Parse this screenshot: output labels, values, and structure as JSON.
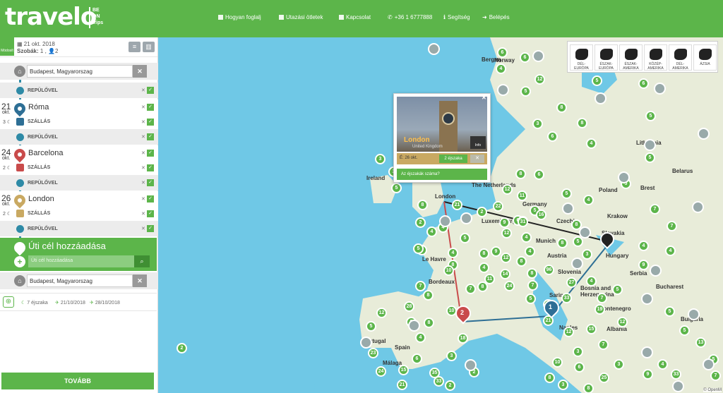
{
  "header": {
    "logo": "travelo",
    "logo_badge": "BE ON trips",
    "nav": [
      {
        "label": "Hogyan foglalj",
        "icon": "book-icon"
      },
      {
        "label": "Utazási ötletek",
        "icon": "book-icon"
      },
      {
        "label": "Kapcsolat",
        "icon": "book-icon"
      },
      {
        "label": "+36 1 6777888",
        "icon": "phone-icon"
      },
      {
        "label": "Segítség",
        "icon": "info-icon"
      },
      {
        "label": "Belépés",
        "icon": "login-icon"
      }
    ]
  },
  "sidebar": {
    "modosit_label": "Módosít",
    "trip_date": "21 okt. 2018",
    "rooms_label": "Szobák:",
    "rooms_value": "1 ,",
    "persons_value": "2",
    "start_place": "Budapest, Magyarorszag",
    "end_place": "Budapest, Magyarorszag",
    "leg_label": "REPÜLŐVEL",
    "stay_label": "SZÁLLÁS",
    "stops": [
      {
        "day": "21",
        "month": "okt.",
        "city": "Róma",
        "nights": "3",
        "color": "#2e6f95"
      },
      {
        "day": "24",
        "month": "okt.",
        "city": "Barcelona",
        "nights": "2",
        "color": "#c94b4b"
      },
      {
        "day": "26",
        "month": "okt.",
        "city": "London",
        "nights": "2",
        "color": "#c9a962"
      }
    ],
    "add_title": "Úti cél hozzáadása",
    "add_placeholder": "Úti cél hozzáadása",
    "summary_nights": "7 éjszaka",
    "summary_depart": "21/10/2018",
    "summary_return": "28/10/2018",
    "next_button": "TOVÁBB"
  },
  "map": {
    "regions": [
      "DÉL-EURÓPA",
      "ÉSZAK-EURÓPA",
      "ÉSZAK-AMERIKA",
      "KÖZÉP-AMERIKA",
      "DÉL-AMERIKA",
      "ÁZSIA"
    ],
    "labels": [
      "Norway",
      "Ireland",
      "Lithuania",
      "Belarus",
      "Poland",
      "Brest",
      "Krakow",
      "Slovakia",
      "Hungary",
      "Germany",
      "Czechia",
      "Austria",
      "Munich",
      "Slovenia",
      "Luxembourg",
      "Bucharest",
      "Bosnia and Herzegovina",
      "Montenegro",
      "Albania",
      "Naples",
      "Bordeaux",
      "Spain",
      "Portugal",
      "Málaga",
      "Bergen",
      "Le Havre",
      "Sarino",
      "The Netherlands",
      "London",
      "Bulgaria",
      "Serbia"
    ],
    "clusters": [
      "6",
      "6",
      "12",
      "8",
      "5",
      "4",
      "6",
      "5",
      "5",
      "8",
      "3",
      "6",
      "4",
      "5",
      "5",
      "2",
      "8",
      "5",
      "12",
      "6",
      "3",
      "3",
      "5",
      "8",
      "11",
      "5",
      "8",
      "4",
      "7",
      "7",
      "4",
      "8",
      "3",
      "22",
      "12",
      "9",
      "4",
      "2",
      "4",
      "4",
      "2",
      "9",
      "6",
      "16",
      "31",
      "4",
      "5",
      "7",
      "5",
      "8",
      "8",
      "4",
      "4",
      "5",
      "14",
      "7",
      "8",
      "4",
      "12",
      "7",
      "5",
      "9",
      "24",
      "8",
      "8",
      "10",
      "8",
      "31",
      "21",
      "7",
      "19",
      "5",
      "4",
      "10",
      "96",
      "7",
      "33",
      "11",
      "27",
      "14",
      "21",
      "12",
      "15",
      "7",
      "12",
      "5",
      "5",
      "3",
      "4",
      "13",
      "5",
      "3",
      "8",
      "28",
      "12",
      "5",
      "9",
      "4",
      "18",
      "3",
      "15",
      "6",
      "35",
      "24",
      "23",
      "33",
      "21",
      "2",
      "2",
      "3",
      "10",
      "8",
      "6",
      "25",
      "9",
      "33",
      "7",
      "8",
      "23"
    ],
    "popup": {
      "city": "London",
      "country": "United Kingdom",
      "info": "Info",
      "arrival": "É: 26 okt.",
      "nights": "2 éjszaka",
      "question": "Az éjszakák száma?"
    },
    "markers": [
      "1",
      "2"
    ],
    "attribution": "© OpenM"
  }
}
